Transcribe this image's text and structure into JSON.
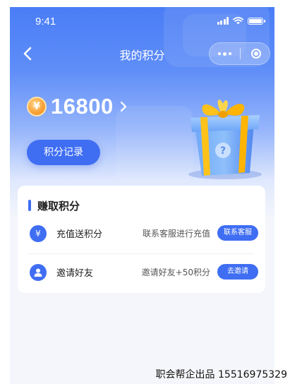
{
  "status_bar": {
    "time": "9:41"
  },
  "nav": {
    "title": "我的积分"
  },
  "points": {
    "coin_symbol": "¥",
    "value": "16800"
  },
  "record_button": {
    "label": "积分记录"
  },
  "earn_section": {
    "title": "赚取积分",
    "items": [
      {
        "icon": "yen-icon",
        "icon_glyph": "¥",
        "label": "充值送积分",
        "description": "联系客服进行充值",
        "button": "联系客服"
      },
      {
        "icon": "user-icon",
        "label": "邀请好友",
        "description": "邀请好友+50积分",
        "button": "去邀请"
      }
    ]
  },
  "footer": {
    "note": "职会帮企出品 15516975329"
  },
  "colors": {
    "primary": "#3f6ef3",
    "coin": "#f9a43a",
    "page_bg": "#f4f6fb"
  }
}
